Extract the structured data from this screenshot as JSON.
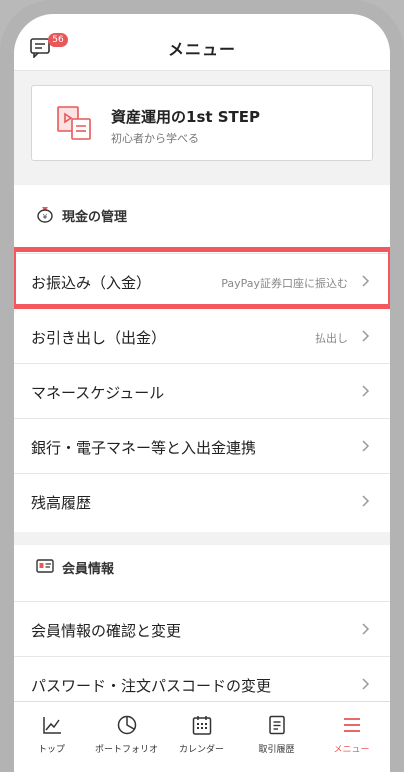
{
  "header": {
    "title": "メニュー",
    "badge_count": "56"
  },
  "step_card": {
    "title": "資産運用の1st STEP",
    "subtitle": "初心者から学べる"
  },
  "cash_section": {
    "title": "現金の管理",
    "items": [
      {
        "label": "お振込み（入金）",
        "sub": "PayPay証券口座に振込む"
      },
      {
        "label": "お引き出し（出金）",
        "sub": "払出し"
      },
      {
        "label": "マネースケジュール",
        "sub": ""
      },
      {
        "label": "銀行・電子マネー等と入出金連携",
        "sub": ""
      },
      {
        "label": "残高履歴",
        "sub": ""
      }
    ]
  },
  "member_section": {
    "title": "会員情報",
    "items": [
      {
        "label": "会員情報の確認と変更"
      },
      {
        "label": "パスワード・注文パスコードの変更"
      }
    ]
  },
  "tabs": [
    {
      "label": "トップ",
      "icon": "chart-line-icon"
    },
    {
      "label": "ポートフォリオ",
      "icon": "pie-chart-icon"
    },
    {
      "label": "カレンダー",
      "icon": "calendar-icon"
    },
    {
      "label": "取引履歴",
      "icon": "document-icon"
    },
    {
      "label": "メニュー",
      "icon": "hamburger-icon"
    }
  ],
  "colors": {
    "accent": "#e8585a",
    "highlight": "#f4585f"
  }
}
